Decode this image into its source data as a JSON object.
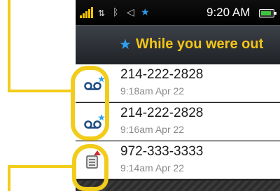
{
  "status_bar": {
    "time": "9:20 AM",
    "icons": [
      "signal-icon",
      "data-icon",
      "bluetooth-icon",
      "volume-icon",
      "star-icon",
      "battery-icon"
    ]
  },
  "header": {
    "title": "While you were out",
    "icon": "star-icon"
  },
  "notifications": [
    {
      "number": "214-222-2828",
      "time": "9:18am Apr 22",
      "icon": "voicemail-icon"
    },
    {
      "number": "214-222-2828",
      "time": "9:16am Apr 22",
      "icon": "voicemail-icon"
    },
    {
      "number": "972-333-3333",
      "time": "9:14am Apr 22",
      "icon": "message-icon"
    }
  ],
  "colors": {
    "callout": "#f2cc1a",
    "header_title": "#f3c319",
    "accent_star": "#2fa0ee"
  }
}
